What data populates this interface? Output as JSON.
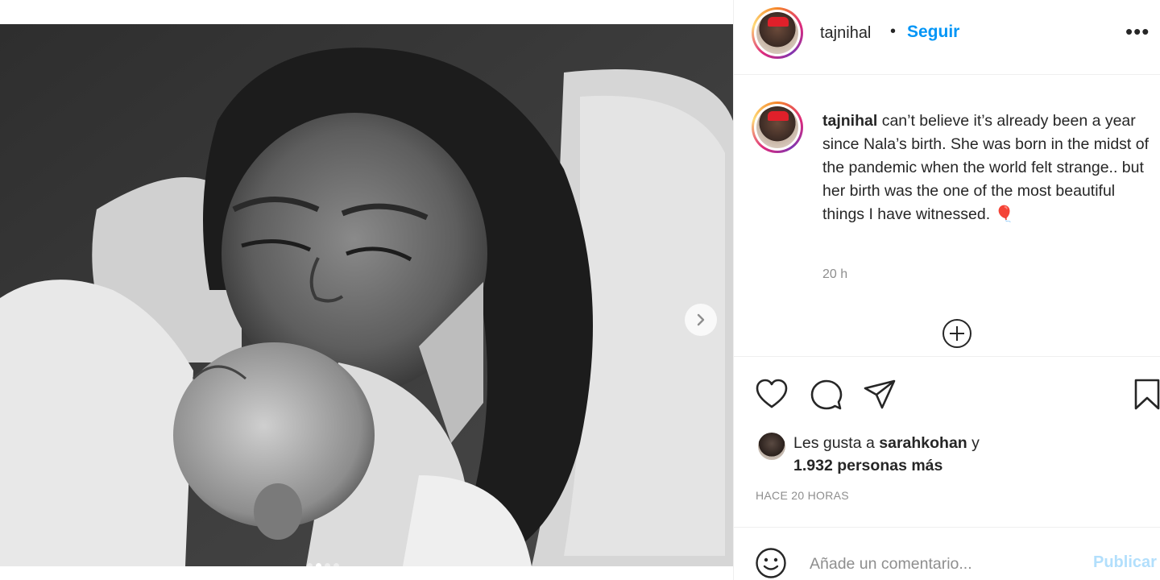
{
  "post": {
    "username": "tajnihal",
    "separator": "•",
    "follow_label": "Seguir",
    "more_label": "•••",
    "caption_user": "tajnihal",
    "caption_text": "can’t believe it’s already been a year since Nala’s birth. She was born in the midst of the pandemic when the world felt strange.. but her birth was the one of the most beautiful things I have witnessed.",
    "caption_emoji": "🎈",
    "caption_time": "20 h",
    "carousel": {
      "total_slides": 4,
      "active_slide": 2
    }
  },
  "likes": {
    "prefix": "Les gusta a",
    "liker": "sarahkohan",
    "conjunction": "y",
    "others": "1.932 personas más"
  },
  "timestamp": "HACE 20 HORAS",
  "comment": {
    "placeholder": "Añade un comentario...",
    "publish_label": "Publicar"
  },
  "icons": {
    "like": "heart-icon",
    "comment": "comment-icon",
    "share": "send-icon",
    "save": "bookmark-icon",
    "emoji": "emoji-icon",
    "more_replies": "plus-circle-icon",
    "next": "chevron-right-icon"
  },
  "colors": {
    "link": "#0095f6",
    "publish_disabled": "#b2dffc",
    "muted": "#8e8e8e",
    "text": "#262626"
  }
}
